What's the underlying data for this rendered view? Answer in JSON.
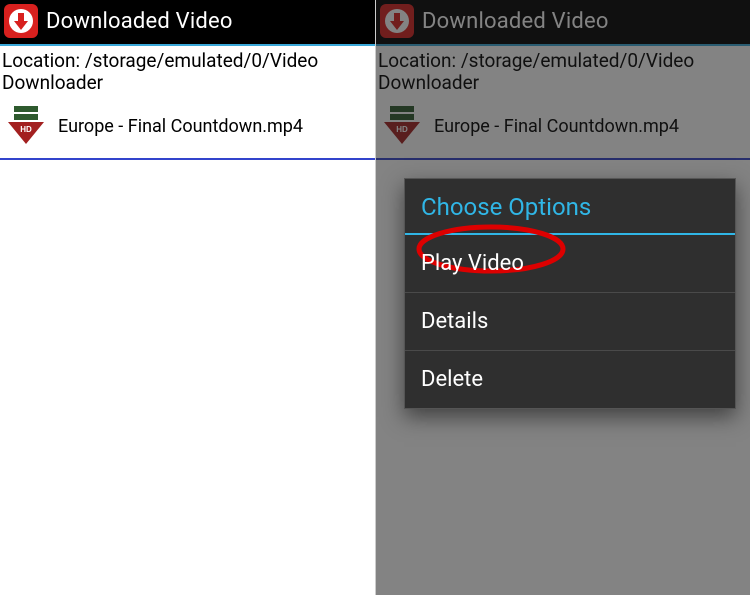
{
  "left": {
    "title": "Downloaded Video",
    "location": "Location: /storage/emulated/0/Video Downloader",
    "file": "Europe - Final Countdown.mp4"
  },
  "right": {
    "title": "Downloaded Video",
    "location": "Location: /storage/emulated/0/Video Downloader",
    "file": "Europe - Final Countdown.mp4",
    "dialog": {
      "title": "Choose Options",
      "items": [
        "Play Video",
        "Details",
        "Delete"
      ]
    }
  }
}
